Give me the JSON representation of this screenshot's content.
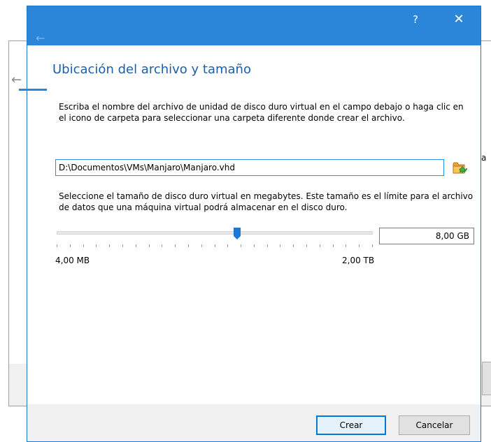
{
  "dialog": {
    "help_glyph": "?",
    "close_glyph": "✕",
    "back_glyph": "←",
    "title": "Ubicación del archivo y tamaño",
    "instructions": "Escriba el nombre del archivo de unidad de disco duro virtual en el campo debajo o haga clic en el icono de carpeta para seleccionar una carpeta diferente donde crear el archivo.",
    "file_path": "D:\\Documentos\\VMs\\Manjaro\\Manjaro.vhd",
    "size_instructions": "Seleccione el tamaño de disco duro virtual en megabytes. Este tamaño es el límite para el archivo de datos que una máquina virtual podrá almacenar en el disco duro.",
    "size_value": "8,00 GB",
    "slider_position": 0.57,
    "slider_min_label": "4,00 MB",
    "slider_max_label": "2,00 TB",
    "create_label": "Crear",
    "cancel_label": "Cancelar"
  },
  "background": {
    "back_glyph": "←",
    "side_char": "a"
  },
  "colors": {
    "titlebar": "#2b86d9",
    "title_text": "#1b5ea8",
    "accent": "#0078d7",
    "slider_thumb": "#1b76d8"
  },
  "icons": [
    "back-arrow-icon",
    "help-icon",
    "close-icon",
    "folder-icon",
    "slider-thumb-icon"
  ]
}
